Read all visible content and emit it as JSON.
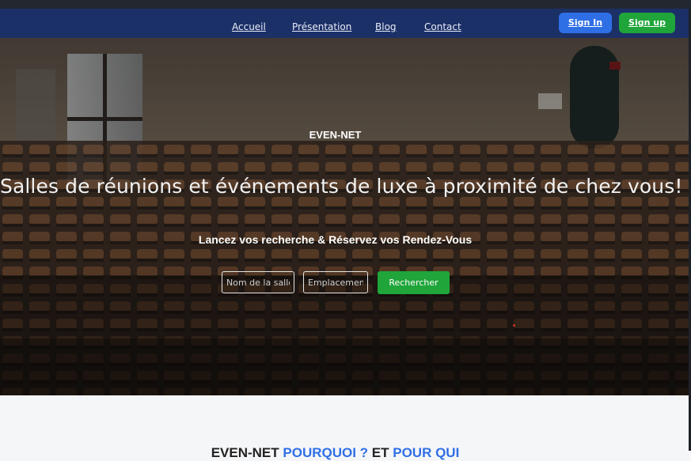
{
  "nav": {
    "links": [
      "Accueil",
      "Présentation",
      "Blog",
      "Contact"
    ],
    "signin_label": "Sign In",
    "signup_label": "Sign up"
  },
  "hero": {
    "brand": "EVEN-NET",
    "headline": "Salles de réunions et événements de luxe à proximité de chez vous!",
    "subline": "Lancez vos recherche & Réservez vos Rendez-Vous",
    "search": {
      "room_placeholder": "Nom de la salle",
      "place_placeholder": "Emplacement",
      "button_label": "Rechercher"
    }
  },
  "section": {
    "title_prefix": "EVEN-NET ",
    "title_accent1": "POURQUOI ?",
    "title_middle": " ET ",
    "title_accent2": "POUR QUI"
  },
  "colors": {
    "navbar": "#1c3068",
    "signin": "#2f6fe6",
    "signup": "#1fa53a",
    "search_button": "#1fa53a"
  }
}
